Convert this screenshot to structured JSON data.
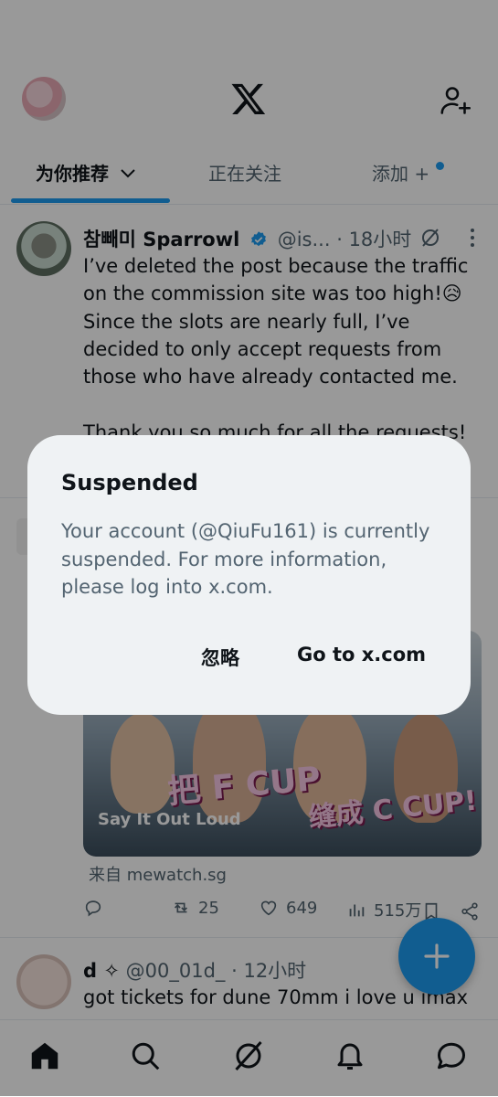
{
  "header": {
    "tabs": [
      {
        "label": "为你推荐"
      },
      {
        "label": "正在关注"
      },
      {
        "label": "添加 +"
      }
    ]
  },
  "tweets": [
    {
      "name": "참빼미 Sparrowl",
      "handle": "@is...",
      "time": "· 18小时",
      "text": "I’ve deleted the post because the traffic on the commission site was too high!😥\nSince the slots are nearly full, I’ve decided to only accept requests from those who have already contacted me.\n\nThank you so much for all the requests!😭"
    },
    {
      "source": "来自 mewatch.sg",
      "media_caption": "Say It Out Loud",
      "media_text_1": "把 F CUP",
      "media_text_2": "缝成 C CUP!",
      "replies": "",
      "retweets": "25",
      "likes": "649",
      "views": "515万"
    },
    {
      "name": "d ✧",
      "handle": "@00_01d_",
      "time": "· 12小时",
      "text": "got tickets for dune 70mm i love u imax"
    }
  ],
  "dialog": {
    "title": "Suspended",
    "message": "Your account (@QiuFu161) is currently suspended. For more information, please log into x.com.",
    "ignore_label": "忽略",
    "goto_label": "Go to x.com"
  },
  "colors": {
    "accent": "#1d9bf0",
    "dialog_bg": "#eff2f4",
    "secondary_text": "#536471"
  }
}
